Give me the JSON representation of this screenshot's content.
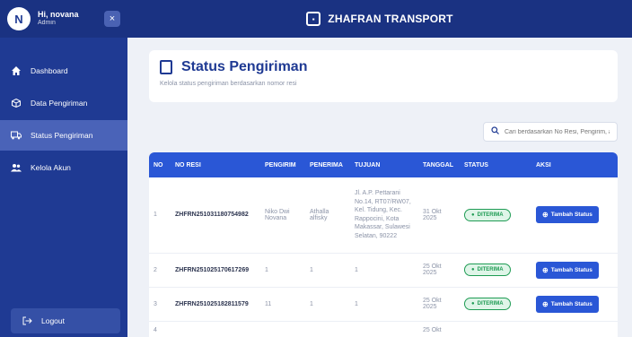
{
  "sidebar": {
    "avatar_letter": "N",
    "user_name": "Hi, novana",
    "user_role": "Admin",
    "close_icon": "×",
    "items": [
      {
        "label": "Dashboard",
        "icon": "home-icon"
      },
      {
        "label": "Data Pengiriman",
        "icon": "box-icon"
      },
      {
        "label": "Status Pengiriman",
        "icon": "truck-icon"
      },
      {
        "label": "Kelola Akun",
        "icon": "users-icon"
      }
    ],
    "logout_label": "Logout"
  },
  "topbar": {
    "brand": "ZHAFRAN TRANSPORT"
  },
  "page": {
    "title": "Status Pengiriman",
    "subtitle": "Kelola status pengiriman berdasarkan nomor resi"
  },
  "search": {
    "placeholder": "Cari berdasarkan No Resi, Pengirim, ata"
  },
  "table": {
    "headers": [
      "NO",
      "NO RESI",
      "PENGIRIM",
      "PENERIMA",
      "TUJUAN",
      "TANGGAL",
      "STATUS",
      "AKSI"
    ],
    "rows": [
      {
        "no": "1",
        "resi": "ZHFRN251031180754982",
        "pengirim": "Niko Dwi Novana",
        "penerima": "Athalla alfisky",
        "tujuan": "Jl. A.P. Pettarani No.14, RT07/RW07, Kel. Tidung, Kec. Rappocini, Kota Makassar, Sulawesi Selatan, 90222",
        "tanggal": "31 Okt 2025",
        "status": "DITERIMA",
        "aksi": "Tambah Status"
      },
      {
        "no": "2",
        "resi": "ZHFRN251025170617269",
        "pengirim": "1",
        "penerima": "1",
        "tujuan": "1",
        "tanggal": "25 Okt 2025",
        "status": "DITERIMA",
        "aksi": "Tambah Status"
      },
      {
        "no": "3",
        "resi": "ZHFRN251025182811579",
        "pengirim": "11",
        "penerima": "1",
        "tujuan": "1",
        "tanggal": "25 Okt 2025",
        "status": "DITERIMA",
        "aksi": "Tambah Status"
      },
      {
        "no": "4",
        "resi": "",
        "pengirim": "",
        "penerima": "",
        "tujuan": "",
        "tanggal": "25 Okt",
        "status": "",
        "aksi": ""
      }
    ]
  },
  "colors": {
    "sidebar": "#1f3a93",
    "topbar": "#1a3282",
    "table_header": "#2a57d6",
    "status_green": "#1f9c54"
  }
}
